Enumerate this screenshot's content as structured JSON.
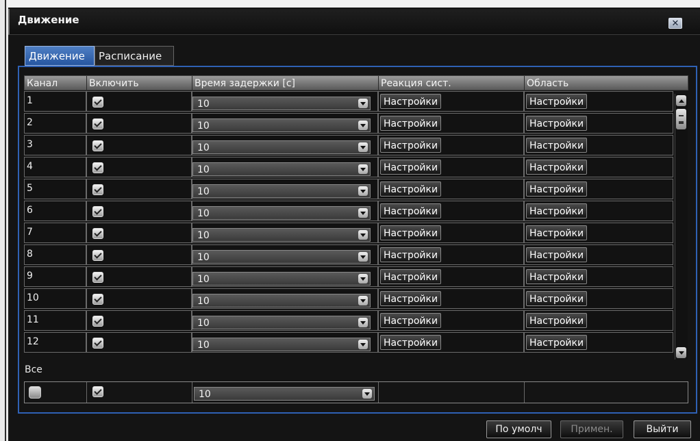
{
  "window": {
    "title": "Движение"
  },
  "tabs": [
    {
      "label": "Движение",
      "active": true
    },
    {
      "label": "Расписание",
      "active": false
    }
  ],
  "columns": [
    "Канал",
    "Включить",
    "Время задержки [с]",
    "Реакция сист.",
    "Область"
  ],
  "rows": [
    {
      "channel": "1",
      "enabled": true,
      "delay": "10",
      "reaction": "Настройки",
      "area": "Настройки"
    },
    {
      "channel": "2",
      "enabled": true,
      "delay": "10",
      "reaction": "Настройки",
      "area": "Настройки"
    },
    {
      "channel": "3",
      "enabled": true,
      "delay": "10",
      "reaction": "Настройки",
      "area": "Настройки"
    },
    {
      "channel": "4",
      "enabled": true,
      "delay": "10",
      "reaction": "Настройки",
      "area": "Настройки"
    },
    {
      "channel": "5",
      "enabled": true,
      "delay": "10",
      "reaction": "Настройки",
      "area": "Настройки"
    },
    {
      "channel": "6",
      "enabled": true,
      "delay": "10",
      "reaction": "Настройки",
      "area": "Настройки"
    },
    {
      "channel": "7",
      "enabled": true,
      "delay": "10",
      "reaction": "Настройки",
      "area": "Настройки"
    },
    {
      "channel": "8",
      "enabled": true,
      "delay": "10",
      "reaction": "Настройки",
      "area": "Настройки"
    },
    {
      "channel": "9",
      "enabled": true,
      "delay": "10",
      "reaction": "Настройки",
      "area": "Настройки"
    },
    {
      "channel": "10",
      "enabled": true,
      "delay": "10",
      "reaction": "Настройки",
      "area": "Настройки"
    },
    {
      "channel": "11",
      "enabled": true,
      "delay": "10",
      "reaction": "Настройки",
      "area": "Настройки"
    },
    {
      "channel": "12",
      "enabled": true,
      "delay": "10",
      "reaction": "Настройки",
      "area": "Настройки"
    }
  ],
  "all": {
    "label": "Все",
    "select_checked": false,
    "enabled": true,
    "delay": "10"
  },
  "footer": {
    "default_label": "По умолч",
    "apply_label": "Примен.",
    "exit_label": "Выйти"
  },
  "colors": {
    "tab_active": "#2f61b5",
    "panel_border": "#2f61b5",
    "background": "#141414"
  }
}
